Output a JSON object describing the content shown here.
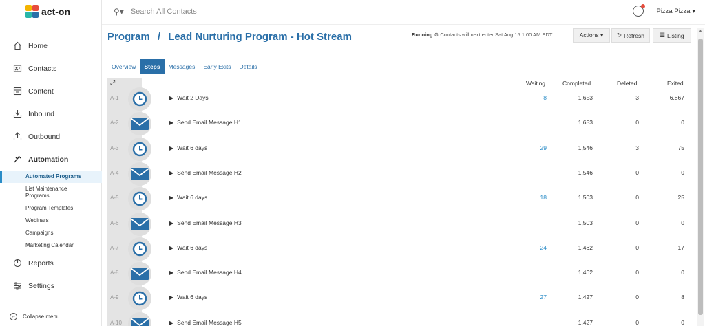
{
  "brand": {
    "logo_text": "act-on"
  },
  "search": {
    "placeholder": "Search All Contacts"
  },
  "account": {
    "name": "Pizza Pizza ▾"
  },
  "sidebar": {
    "items": [
      {
        "label": "Home",
        "icon": "home-icon"
      },
      {
        "label": "Contacts",
        "icon": "contacts-icon"
      },
      {
        "label": "Content",
        "icon": "content-icon"
      },
      {
        "label": "Inbound",
        "icon": "inbound-icon"
      },
      {
        "label": "Outbound",
        "icon": "outbound-icon"
      },
      {
        "label": "Automation",
        "icon": "automation-icon"
      }
    ],
    "automation_sub": [
      "Automated Programs",
      "List Maintenance Programs",
      "Program Templates",
      "Webinars",
      "Campaigns",
      "Marketing Calendar"
    ],
    "bottom_items": [
      {
        "label": "Reports",
        "icon": "reports-icon"
      },
      {
        "label": "Settings",
        "icon": "settings-icon"
      }
    ],
    "collapse_label": "Collapse menu"
  },
  "header": {
    "crumb_root": "Program",
    "separator": "/",
    "crumb_title": "Lead Nurturing Program - Hot Stream",
    "status_state": "Running",
    "status_note": "Contacts will next enter Sat Aug 15 1:00 AM EDT",
    "actions_label": "Actions ▾",
    "refresh_label": "Refresh",
    "listing_label": "Listing"
  },
  "tabs": [
    "Overview",
    "Steps",
    "Messages",
    "Early Exits",
    "Details"
  ],
  "active_tab": "Steps",
  "table": {
    "columns": [
      "Waiting",
      "Completed",
      "Deleted",
      "Exited"
    ],
    "rows": [
      {
        "id": "A-1",
        "type": "wait",
        "name": "Wait 2 Days",
        "waiting": "8",
        "completed": "1,653",
        "deleted": "3",
        "exited": "6,867"
      },
      {
        "id": "A-2",
        "type": "email",
        "name": "Send Email Message H1",
        "waiting": "",
        "completed": "1,653",
        "deleted": "0",
        "exited": "0"
      },
      {
        "id": "A-3",
        "type": "wait",
        "name": "Wait 6 days",
        "waiting": "29",
        "completed": "1,546",
        "deleted": "3",
        "exited": "75"
      },
      {
        "id": "A-4",
        "type": "email",
        "name": "Send Email Message H2",
        "waiting": "",
        "completed": "1,546",
        "deleted": "0",
        "exited": "0"
      },
      {
        "id": "A-5",
        "type": "wait",
        "name": "Wait 6 days",
        "waiting": "18",
        "completed": "1,503",
        "deleted": "0",
        "exited": "25"
      },
      {
        "id": "A-6",
        "type": "email",
        "name": "Send Email Message H3",
        "waiting": "",
        "completed": "1,503",
        "deleted": "0",
        "exited": "0"
      },
      {
        "id": "A-7",
        "type": "wait",
        "name": "Wait 6 days",
        "waiting": "24",
        "completed": "1,462",
        "deleted": "0",
        "exited": "17"
      },
      {
        "id": "A-8",
        "type": "email",
        "name": "Send Email Message H4",
        "waiting": "",
        "completed": "1,462",
        "deleted": "0",
        "exited": "0"
      },
      {
        "id": "A-9",
        "type": "wait",
        "name": "Wait 6 days",
        "waiting": "27",
        "completed": "1,427",
        "deleted": "0",
        "exited": "8"
      },
      {
        "id": "A-10",
        "type": "email",
        "name": "Send Email Message H5",
        "waiting": "",
        "completed": "1,427",
        "deleted": "0",
        "exited": "0"
      }
    ]
  },
  "colors": {
    "accent": "#2a6fa8",
    "link": "#2a8cc7",
    "badge_bg": "#dedede"
  }
}
